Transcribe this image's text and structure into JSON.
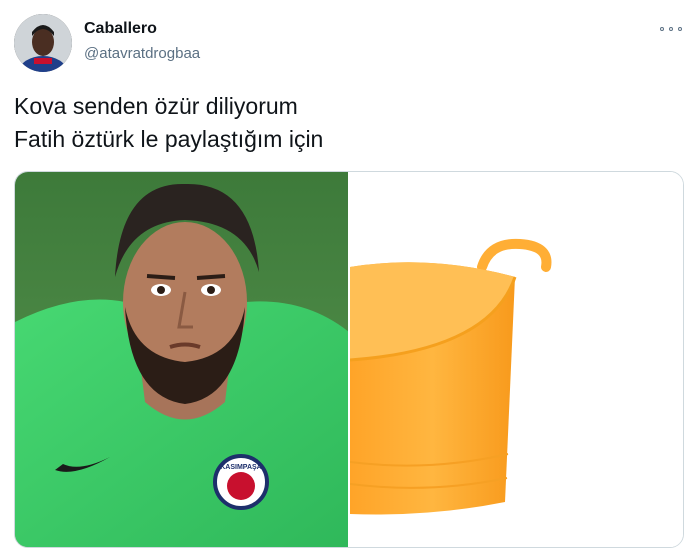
{
  "tweet": {
    "display_name": "Caballero",
    "handle": "@atavratdrogbaa",
    "text_lines": [
      "Kova senden özür diliyorum",
      "Fatih öztürk le paylaştığım için"
    ]
  },
  "media": {
    "left_image_icon": "goalkeeper-photo",
    "right_image_icon": "orange-bucket-photo",
    "badge_text": "KASIMPAŞA"
  },
  "icons": {
    "more": "more-options-icon",
    "avatar": "avatar"
  },
  "colors": {
    "text_primary": "#0f1419",
    "text_secondary": "#5b7083",
    "border": "#cfd9de",
    "jersey_green": "#3ecf6a",
    "bucket_orange": "#ffa62b"
  }
}
